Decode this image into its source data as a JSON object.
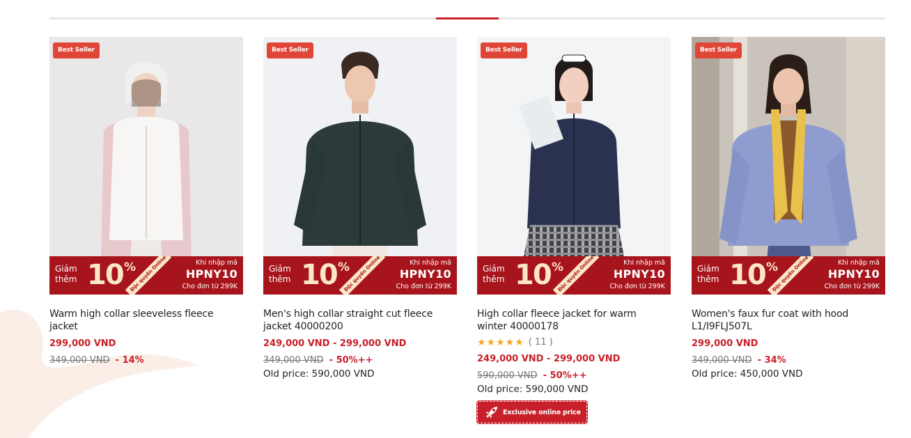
{
  "colors": {
    "accent_red": "#c8202a",
    "badge_red": "#e04638",
    "promo_banner": "#a8141c",
    "star_yellow": "#f5a623"
  },
  "products": [
    {
      "badge": "Best Seller",
      "promo": {
        "giam": "Giảm",
        "them": "thêm",
        "percent": "10",
        "percent_sign": "%",
        "ribbon": "Độc quyền Online",
        "enter_code": "Khi nhập mã",
        "code": "HPNY10",
        "min_order": "Cho đơn từ 299K"
      },
      "title": "Warm high collar sleeveless fleece jacket",
      "price": "299,000 VND",
      "strike_price": "349,000 VND",
      "discount": "- 14%"
    },
    {
      "badge": "Best Seller",
      "promo": {
        "giam": "Giảm",
        "them": "thêm",
        "percent": "10",
        "percent_sign": "%",
        "ribbon": "Độc quyền Online",
        "enter_code": "Khi nhập mã",
        "code": "HPNY10",
        "min_order": "Cho đơn từ 299K"
      },
      "title": "Men's high collar straight cut fleece jacket 40000200",
      "price": "249,000 VND - 299,000 VND",
      "strike_price": "349,000 VND",
      "discount": "- 50%++",
      "old_price": "Old price: 590,000 VND"
    },
    {
      "badge": "Best Seller",
      "promo": {
        "giam": "Giảm",
        "them": "thêm",
        "percent": "10",
        "percent_sign": "%",
        "ribbon": "Độc quyền Online",
        "enter_code": "Khi nhập mã",
        "code": "HPNY10",
        "min_order": "Cho đơn từ 299K"
      },
      "title": "High collar fleece jacket for warm winter 40000178",
      "rating_stars": 5,
      "rating_count": "( 11 )",
      "price": "249,000 VND - 299,000 VND",
      "strike_price": "590,000 VND",
      "discount": "- 50%++",
      "old_price": "Old price: 590,000 VND",
      "exclusive_label": "Exclusive online price",
      "exclusive_icon": "rocket-icon"
    },
    {
      "badge": "Best Seller",
      "promo": {
        "giam": "Giảm",
        "them": "thêm",
        "percent": "10",
        "percent_sign": "%",
        "ribbon": "Độc quyền Online",
        "enter_code": "Khi nhập mã",
        "code": "HPNY10",
        "min_order": "Cho đơn từ 299K"
      },
      "title": "Women's faux fur coat with hood L1/I9FLJ507L",
      "price": "299,000 VND",
      "strike_price": "349,000 VND",
      "discount": "- 34%",
      "old_price": "Old price: 450,000 VND"
    }
  ]
}
